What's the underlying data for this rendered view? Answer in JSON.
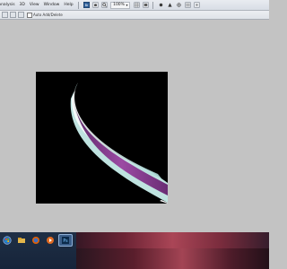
{
  "menubar": {
    "items": [
      "Analysis",
      "3D",
      "View",
      "Window",
      "Help"
    ],
    "zoom_value": "100%"
  },
  "options_bar": {
    "auto_add_delete_label": "Auto Add/Delete"
  },
  "icons": {
    "menubar": [
      "ps-logo-icon",
      "hand-icon",
      "zoom-tool-icon",
      "grid-icon",
      "screen-mode-icon",
      "arrange-icon",
      "rotate-icon",
      "pen-icon",
      "mask-icon"
    ],
    "taskbar": [
      "start-orb-icon",
      "explorer-icon",
      "firefox-icon",
      "media-icon",
      "photoshop-taskbar-icon"
    ]
  },
  "colors": {
    "workspace_bg": "#c3c3c3",
    "canvas_bg": "#000000",
    "stroke_magenta": "#8a3f93",
    "stroke_cyan": "#a7d6d6",
    "taskbar_bg": "#1f2f45"
  }
}
